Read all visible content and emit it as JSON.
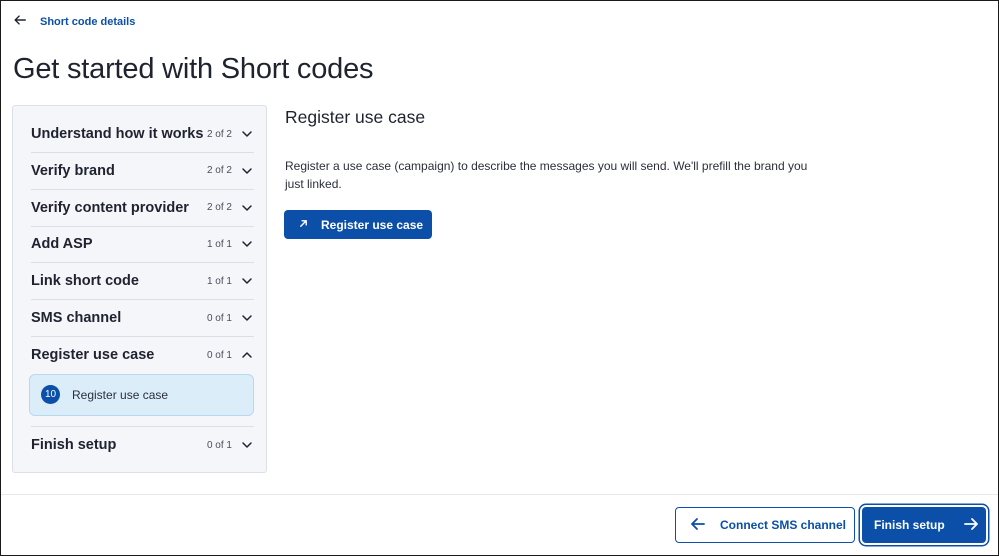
{
  "header": {
    "back_label": "Short code details",
    "title": "Get started with Short codes"
  },
  "steps": [
    {
      "label": "Understand how it works",
      "count": "2 of 2",
      "expanded": false
    },
    {
      "label": "Verify brand",
      "count": "2 of 2",
      "expanded": false
    },
    {
      "label": "Verify content provider",
      "count": "2 of 2",
      "expanded": false
    },
    {
      "label": "Add ASP",
      "count": "1 of 1",
      "expanded": false
    },
    {
      "label": "Link short code",
      "count": "1 of 1",
      "expanded": false
    },
    {
      "label": "SMS channel",
      "count": "0 of 1",
      "expanded": false
    },
    {
      "label": "Register use case",
      "count": "0 of 1",
      "expanded": true
    },
    {
      "label": "Finish setup",
      "count": "0 of 1",
      "expanded": false
    }
  ],
  "active_substep": {
    "number": "10",
    "label": "Register use case"
  },
  "content": {
    "title": "Register use case",
    "description": "Register a use case (campaign) to describe the messages you will send. We'll prefill the brand you just linked.",
    "action_label": "Register use case"
  },
  "footer": {
    "back_label": "Connect SMS channel",
    "next_label": "Finish setup"
  },
  "colors": {
    "accent": "#0b4fa8",
    "panel_bg": "#f4f6f9",
    "active_bg": "#dcedfa"
  }
}
